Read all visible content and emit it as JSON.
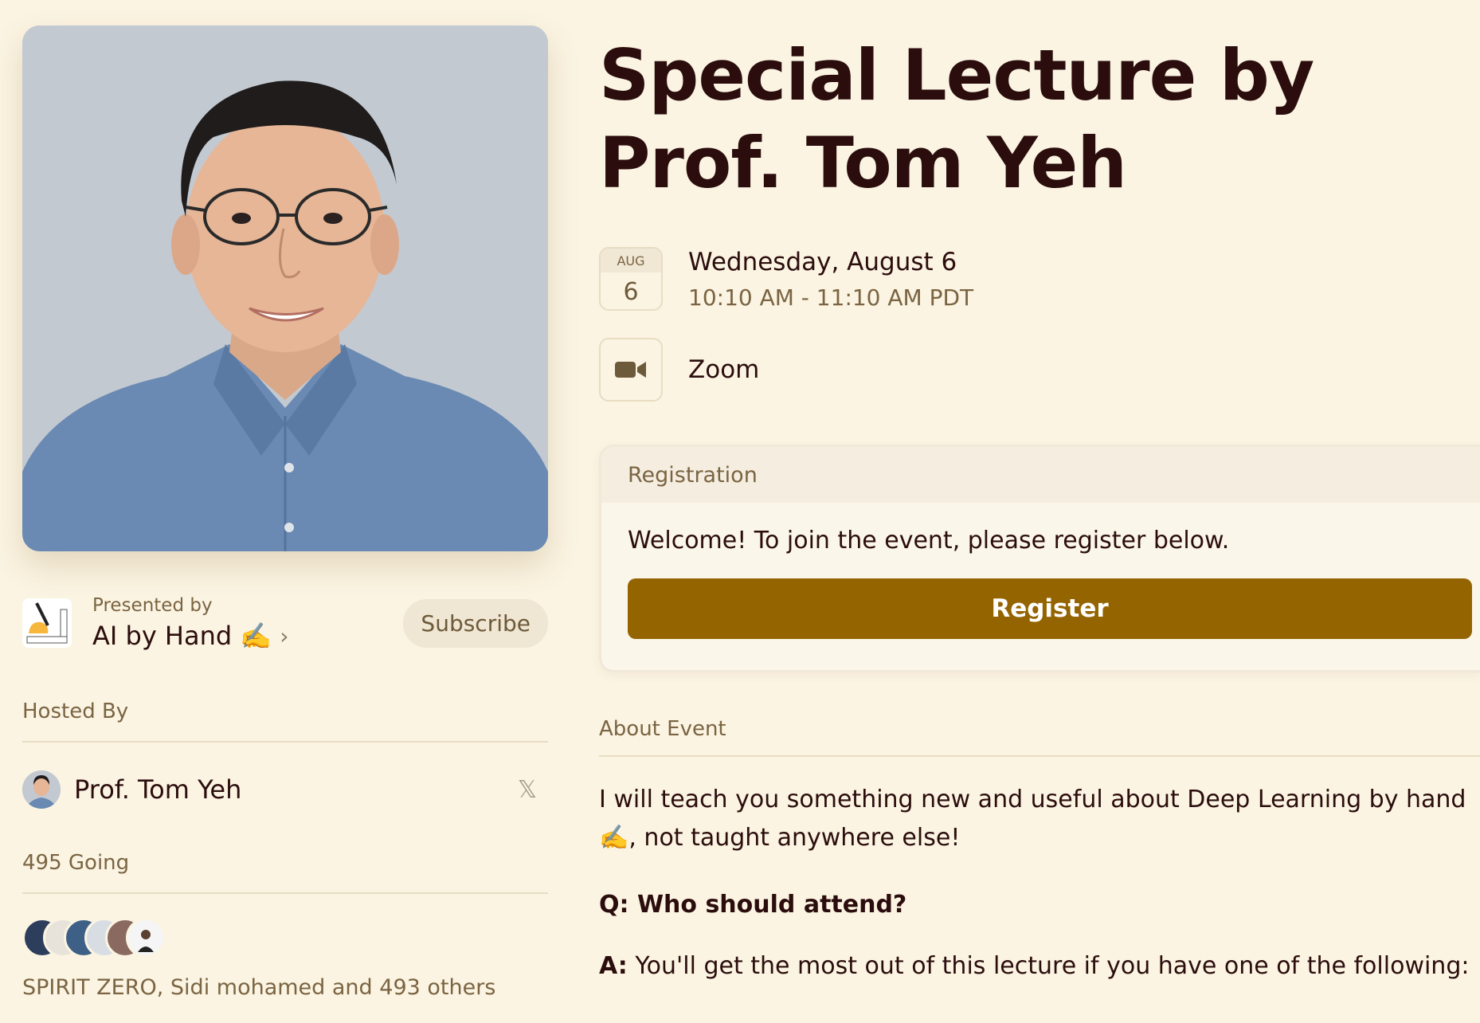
{
  "event": {
    "title": "Special Lecture by Prof. Tom Yeh",
    "calendar": {
      "month": "AUG",
      "day": "6"
    },
    "date_main": "Wednesday, August 6",
    "time_range": "10:10 AM - 11:10 AM PDT",
    "location": "Zoom"
  },
  "presenter": {
    "presented_by_label": "Presented by",
    "name": "AI by Hand ✍️",
    "subscribe_label": "Subscribe"
  },
  "hosts": {
    "label": "Hosted By",
    "items": [
      {
        "name": "Prof. Tom Yeh"
      }
    ]
  },
  "attendance": {
    "going_label": "495 Going",
    "summary": "SPIRIT ZERO, Sidi mohamed and 493 others"
  },
  "registration": {
    "header": "Registration",
    "welcome": "Welcome! To join the event, please register below.",
    "button_label": "Register"
  },
  "about": {
    "label": "About Event",
    "paragraph": "I will teach you something new and useful about Deep Learning by hand ✍️, not taught anywhere else!",
    "q_label": "Q: Who should attend?",
    "a_prefix": "A:",
    "a_text": " You'll get the most out of this lecture if you have one of the following:"
  },
  "colors": {
    "background": "#fbf4e2",
    "accent_button": "#946400",
    "title_text": "#2b0d0d",
    "muted_text": "#7a6442"
  },
  "icons": {
    "location": "video-camera-icon",
    "social": "x-twitter-icon",
    "chevron": "chevron-right-icon"
  }
}
